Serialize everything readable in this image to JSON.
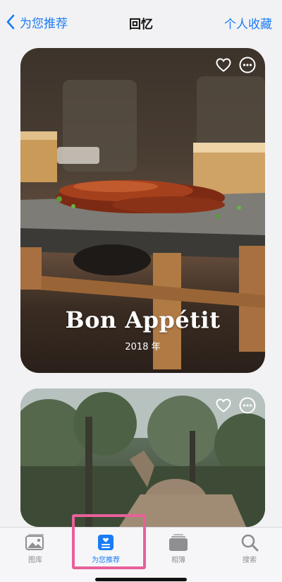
{
  "nav": {
    "back_label": "为您推荐",
    "title": "回忆",
    "right_label": "个人收藏"
  },
  "memories": [
    {
      "title": "Bon Appétit",
      "subtitle": "2018 年"
    },
    {
      "title": "",
      "subtitle": ""
    }
  ],
  "tabs": [
    {
      "label": "图库",
      "icon": "photos-library-icon",
      "active": false
    },
    {
      "label": "为您推荐",
      "icon": "for-you-icon",
      "active": true
    },
    {
      "label": "相簿",
      "icon": "albums-icon",
      "active": false
    },
    {
      "label": "搜索",
      "icon": "search-icon",
      "active": false
    }
  ],
  "colors": {
    "accent": "#1a7cf5",
    "highlight": "#e8609a",
    "inactive": "#8e8e93"
  }
}
